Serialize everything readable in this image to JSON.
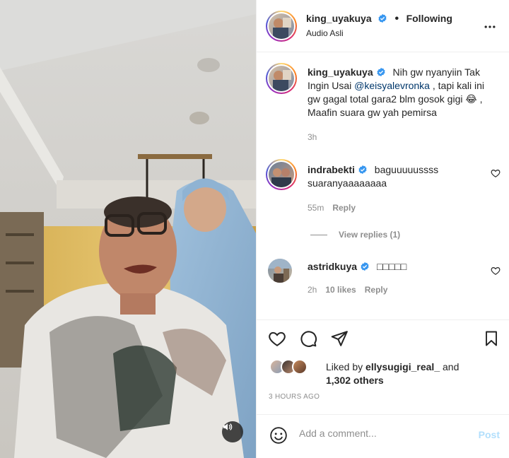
{
  "post": {
    "author": "king_uyakuya",
    "follow_status": "Following",
    "audio": "Audio Asli",
    "more_icon": "more-horizontal-icon"
  },
  "caption": {
    "author": "king_uyakuya",
    "text_before": "Nih gw nyanyiin Tak Ingin Usai ",
    "mention": "@keisyalevronka",
    "text_after": " , tapi kali ini gw gagal total gara2 blm gosok gigi 😂 , Maafin suara gw yah pemirsa",
    "time": "3h"
  },
  "comments": [
    {
      "author": "indrabekti",
      "text": "baguuuuussss suaranyaaaaaaaa",
      "time": "55m",
      "likes": "",
      "reply_label": "Reply",
      "view_replies": "View replies (1)"
    },
    {
      "author": "astridkuya",
      "text": "□□□□□",
      "time": "2h",
      "likes": "10 likes",
      "reply_label": "Reply"
    }
  ],
  "likes": {
    "prefix": "Liked by ",
    "user": "ellysugigi_real_",
    "middle": " and",
    "count": "1,302 others"
  },
  "timestamp": "3 HOURS AGO",
  "comment_box": {
    "placeholder": "Add a comment...",
    "post_label": "Post"
  },
  "colors": {
    "verified": "#3897f0",
    "mention": "#00376b",
    "muted": "#8e8e8e",
    "post_disabled": "#b2dffc"
  }
}
